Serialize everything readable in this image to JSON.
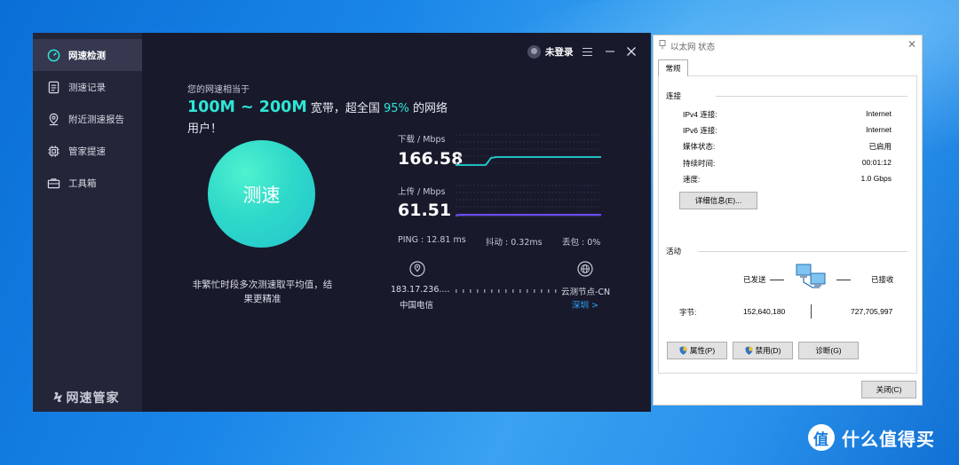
{
  "speedtest": {
    "sidebar": {
      "items": [
        {
          "label": "网速检测",
          "icon": "speedometer-icon",
          "active": true
        },
        {
          "label": "测速记录",
          "icon": "document-icon"
        },
        {
          "label": "附近测速报告",
          "icon": "location-icon"
        },
        {
          "label": "管家提速",
          "icon": "chip-icon"
        },
        {
          "label": "工具箱",
          "icon": "toolbox-icon"
        }
      ],
      "logo": "网速管家"
    },
    "header": {
      "user_label": "未登录"
    },
    "result": {
      "intro": "您的网速相当于",
      "range": "100M ~ 200M",
      "text_before_pct": " 宽带，超全国 ",
      "percent": "95%",
      "text_after_pct": " 的网络用户！"
    },
    "action": {
      "label": "测速"
    },
    "tip": "非繁忙时段多次测速取平均值，结果更精准",
    "download": {
      "label": "下载 / Mbps",
      "value": "166.58"
    },
    "upload": {
      "label": "上传 / Mbps",
      "value": "61.51"
    },
    "stats": {
      "ping": "PING : 12.81 ms",
      "jitter": "抖动 : 0.32ms",
      "loss": "丢包 : 0%"
    },
    "route": {
      "client_ip": "183.17.236....",
      "client_isp": "中国电信",
      "server_name": "云测节点-CN",
      "server_city": "深圳 >"
    },
    "colors": {
      "accent": "#2ee6d6",
      "download_line": "#22d3d6",
      "upload_line": "#6b4cff"
    }
  },
  "ethernet_dialog": {
    "title": "以太网 状态",
    "tab": "常规",
    "connection": {
      "group": "连接",
      "rows": [
        {
          "key": "IPv4 连接:",
          "value": "Internet"
        },
        {
          "key": "IPv6 连接:",
          "value": "Internet"
        },
        {
          "key": "媒体状态:",
          "value": "已启用"
        },
        {
          "key": "持续时间:",
          "value": "00:01:12"
        },
        {
          "key": "速度:",
          "value": "1.0 Gbps"
        }
      ],
      "details_button": "详细信息(E)..."
    },
    "activity": {
      "group": "活动",
      "sent_label": "已发送",
      "received_label": "已接收",
      "bytes_label": "字节:",
      "bytes_sent": "152,640,180",
      "bytes_received": "727,705,997"
    },
    "buttons": {
      "properties": "属性(P)",
      "disable": "禁用(D)",
      "diagnose": "诊断(G)",
      "close": "关闭(C)"
    }
  },
  "watermark": {
    "badge": "值",
    "text": "什么值得买"
  }
}
